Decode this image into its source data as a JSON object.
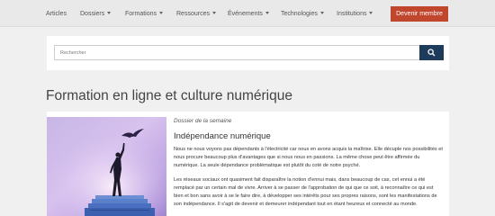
{
  "nav": {
    "items": [
      {
        "label": "Articles",
        "dropdown": false
      },
      {
        "label": "Dossiers",
        "dropdown": true
      },
      {
        "label": "Formations",
        "dropdown": true
      },
      {
        "label": "Ressources",
        "dropdown": true
      },
      {
        "label": "Événements",
        "dropdown": true
      },
      {
        "label": "Technologies",
        "dropdown": true
      },
      {
        "label": "Institutions",
        "dropdown": true
      }
    ],
    "member_button": "Devenir membre"
  },
  "search": {
    "placeholder": "Rechercher",
    "icon": "search-icon"
  },
  "page": {
    "title": "Formation en ligne et culture numérique"
  },
  "feature": {
    "kicker": "Dossier de la semaine",
    "title": "Indépendance numérique",
    "paragraphs": [
      "Nous ne nous voyons pas dépendants à l'électricité car nous en avons acquis la maîtrise. Elle décuple nos possibilités et nous procure beaucoup plus d'avantages que si nous nous en passions. La même chose peut être affirmée du numérique. La seule dépendance problématique est plutôt du coté de notre psyché.",
      "Les réseaux sociaux ont quasiment fait disparaître la notion d'ennui mais, dans beaucoup de cas, cet ennui a été remplacé par un certain mal de vivre. Arriver à se passer de l'approbation de qui que ce soit, à reconnaître ce qui est bien et bon sans avoir à se le faire dire, à développer ses intérêts pour ses propres raisons, sont les manifestations de son indépendance. Il s'agit de devenir et demeurer indépendant tout en étant heureux et connecté au monde."
    ]
  },
  "colors": {
    "nav_bg": "#e9e9e9",
    "accent": "#c1462e",
    "search_button": "#1d3c5b",
    "page_bg": "#f0f0f0"
  }
}
